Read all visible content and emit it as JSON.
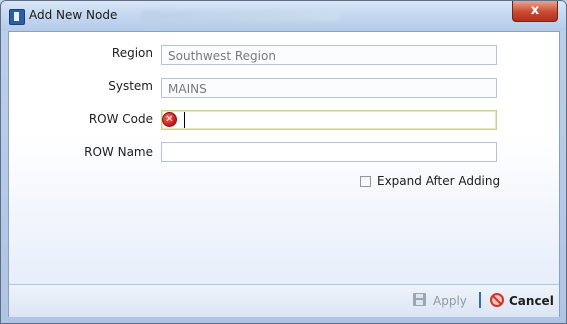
{
  "window": {
    "title": "Add New Node",
    "close_glyph": "x"
  },
  "form": {
    "region": {
      "label": "Region",
      "value": "Southwest Region"
    },
    "system": {
      "label": "System",
      "value": "MAINS"
    },
    "row_code": {
      "label": "ROW Code",
      "value": "",
      "error_icon": "error-icon"
    },
    "row_name": {
      "label": "ROW Name",
      "value": ""
    },
    "expand_after_adding": {
      "label": "Expand After Adding",
      "checked": false
    }
  },
  "footer": {
    "apply_label": "Apply",
    "cancel_label": "Cancel"
  },
  "colors": {
    "accent": "#2f6fb4",
    "error": "#c0161a"
  }
}
